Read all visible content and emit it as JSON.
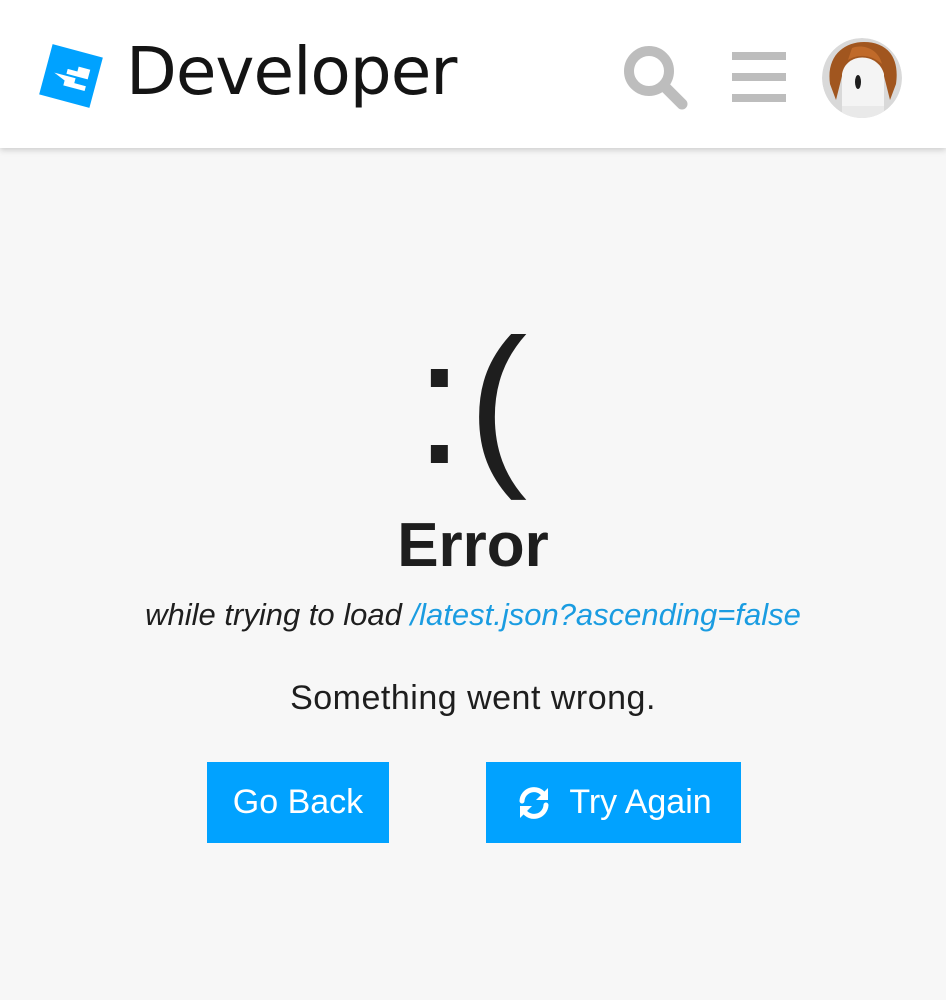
{
  "header": {
    "brand": "Developer",
    "logo_icon": "roblox-logo-icon",
    "search_icon": "search-icon",
    "menu_icon": "hamburger-menu-icon",
    "avatar_icon": "user-avatar",
    "accent_color": "#00a2ff"
  },
  "error": {
    "face": ":(",
    "title": "Error",
    "subtitle_prefix": "while trying to load",
    "path": "/latest.json?ascending=false",
    "message": "Something went wrong."
  },
  "actions": {
    "back_label": "Go Back",
    "retry_label": "Try Again",
    "retry_icon": "refresh-icon",
    "button_color": "#01a2ff"
  }
}
